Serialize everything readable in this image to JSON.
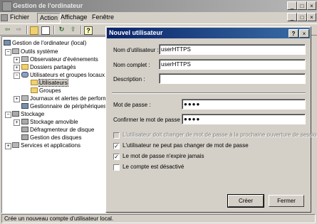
{
  "window": {
    "title": "Gestion de l'ordinateur",
    "buttons": {
      "minimize": "_",
      "maximize": "□",
      "close": "×"
    }
  },
  "menu": [
    "Fichier",
    "Action",
    "Affichage",
    "Fenêtre"
  ],
  "toolbar": {
    "icons": [
      "back-arrow-icon",
      "forward-arrow-icon",
      "up-folder-icon",
      "tree-toggle-icon",
      "refresh-icon",
      "export-icon",
      "help-icon"
    ]
  },
  "tree": [
    {
      "label": "Gestion de l'ordinateur (local)"
    },
    {
      "label": "Outils système"
    },
    {
      "label": "Observateur d'événements"
    },
    {
      "label": "Dossiers partagés"
    },
    {
      "label": "Utilisateurs et groupes locaux"
    },
    {
      "label": "Utilisateurs"
    },
    {
      "label": "Groupes"
    },
    {
      "label": "Journaux et alertes de perform"
    },
    {
      "label": "Gestionnaire de périphériques"
    },
    {
      "label": "Stockage"
    },
    {
      "label": "Stockage amovible"
    },
    {
      "label": "Défragmenteur de disque"
    },
    {
      "label": "Gestion des disques"
    },
    {
      "label": "Services et applications"
    }
  ],
  "statusbar": "Crée un nouveau compte d'utilisateur local.",
  "dialog": {
    "title": "Nouvel utilisateur",
    "title_buttons": {
      "help": "?",
      "close": "×"
    },
    "fields": {
      "username": {
        "label": "Nom d'utilisateur :",
        "value": "userHTTPS"
      },
      "fullname": {
        "label": "Nom complet :",
        "value": "userHTTPS"
      },
      "description": {
        "label": "Description :",
        "value": ""
      },
      "password": {
        "label": "Mot de passe :",
        "value": "●●●●"
      },
      "confirm": {
        "label": "Confirmer le mot de passe :",
        "value": "●●●●"
      }
    },
    "checkboxes": [
      {
        "label": "L'utilisateur doit changer de mot de passe à la prochaine ouverture de session",
        "checked": false,
        "disabled": true,
        "mark": ""
      },
      {
        "label": "L'utilisateur ne peut pas changer de mot de passe",
        "checked": true,
        "disabled": false,
        "mark": "✓"
      },
      {
        "label": "Le mot de passe n'expire jamais",
        "checked": true,
        "disabled": false,
        "mark": "✓"
      },
      {
        "label": "Le compte est désactivé",
        "checked": false,
        "disabled": false,
        "mark": ""
      }
    ],
    "buttons": {
      "create": "Créer",
      "close": "Fermer"
    }
  },
  "colors": {
    "dialog_title": "#0a246a",
    "inactive_title": "#7c7c7c",
    "face": "#d4d0c8"
  }
}
